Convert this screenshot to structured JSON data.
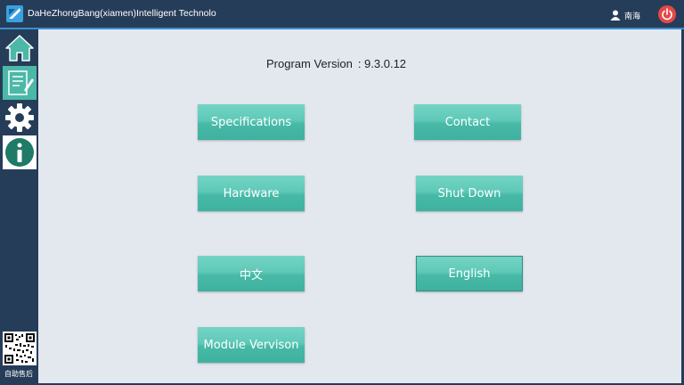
{
  "titlebar": {
    "app_title": "DaHeZhongBang(xiamen)Intelligent Technolo",
    "user_name": "南海",
    "icons": [
      "app-logo-icon",
      "user-icon",
      "power-icon"
    ]
  },
  "sidebar": {
    "items": [
      {
        "name": "home",
        "icon": "home-icon"
      },
      {
        "name": "records",
        "icon": "edit-document-icon"
      },
      {
        "name": "settings",
        "icon": "gear-icon"
      },
      {
        "name": "info",
        "icon": "info-icon",
        "active": true
      }
    ],
    "qr_label": "自助售后"
  },
  "main": {
    "version_label": "Program Version",
    "version_value": ": 9.3.0.12",
    "buttons": {
      "specifications": "Specifications",
      "contact": "Contact",
      "hardware": "Hardware",
      "shut_down": "Shut Down",
      "chinese": "中文",
      "english": "English",
      "module_version": "Module Vervison"
    },
    "selected_language": "English"
  },
  "colors": {
    "frame": "#263d59",
    "accent_line": "#3a8fd0",
    "content_bg": "#e3e7ee",
    "button_teal": "#4bb8a8",
    "power_red": "#e54848"
  }
}
